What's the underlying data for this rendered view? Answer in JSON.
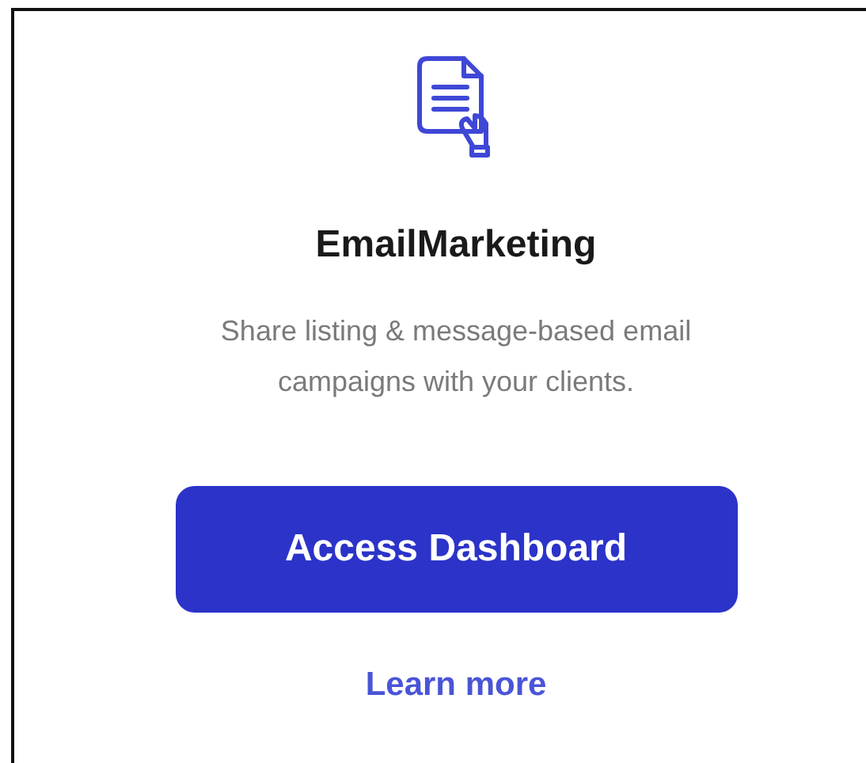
{
  "card": {
    "title": "EmailMarketing",
    "description": "Share listing & message-based email campaigns with your clients.",
    "button": "Access Dashboard",
    "link": "Learn more"
  }
}
